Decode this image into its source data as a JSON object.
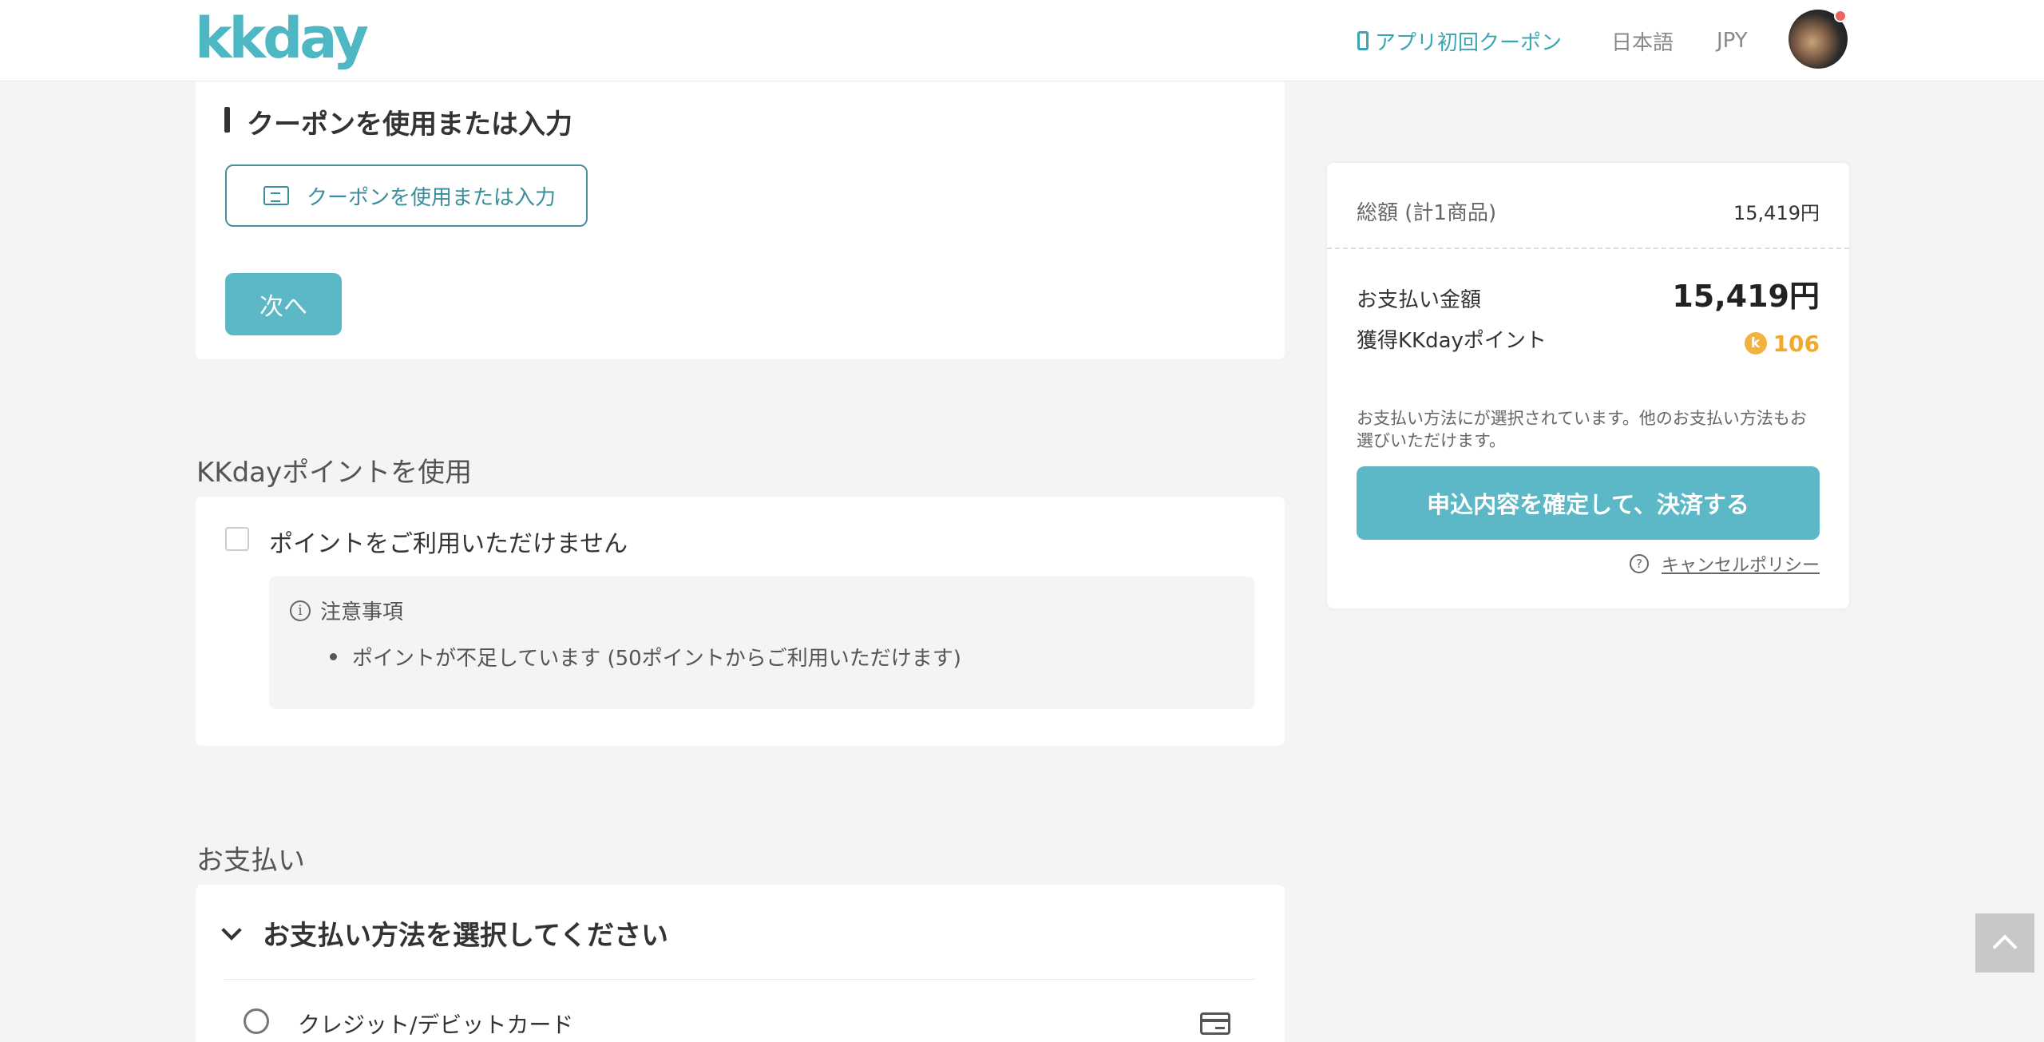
{
  "header": {
    "logo": "kkday",
    "app_coupon": "アプリ初回クーポン",
    "language": "日本語",
    "currency": "JPY"
  },
  "coupon": {
    "title": "クーポンを使用または入力",
    "button_label": "クーポンを使用または入力",
    "next_label": "次へ"
  },
  "points": {
    "section_title": "KKdayポイントを使用",
    "checkbox_label": "ポイントをご利用いただけません",
    "notice_title": "注意事項",
    "notice_item": "ポイントが不足しています (50ポイントからご利用いただけます)"
  },
  "payment": {
    "section_title": "お支払い",
    "select_title": "お支払い方法を選択してください",
    "option_card": "クレジット/デビットカード"
  },
  "summary": {
    "total_label": "総額 (計1商品)",
    "total_value": "15,419円",
    "pay_label": "お支払い金額",
    "pay_value": "15,419円",
    "points_label": "獲得KKdayポイント",
    "points_value": "106",
    "note": "お支払い方法にが選択されています。他のお支払い方法もお選びいただけます。",
    "confirm_label": "申込内容を確定して、決済する",
    "cancel_policy": "キャンセルポリシー"
  },
  "colors": {
    "brand": "#4eb7c4",
    "button": "#5cb8c6",
    "points": "#f0a92a"
  }
}
